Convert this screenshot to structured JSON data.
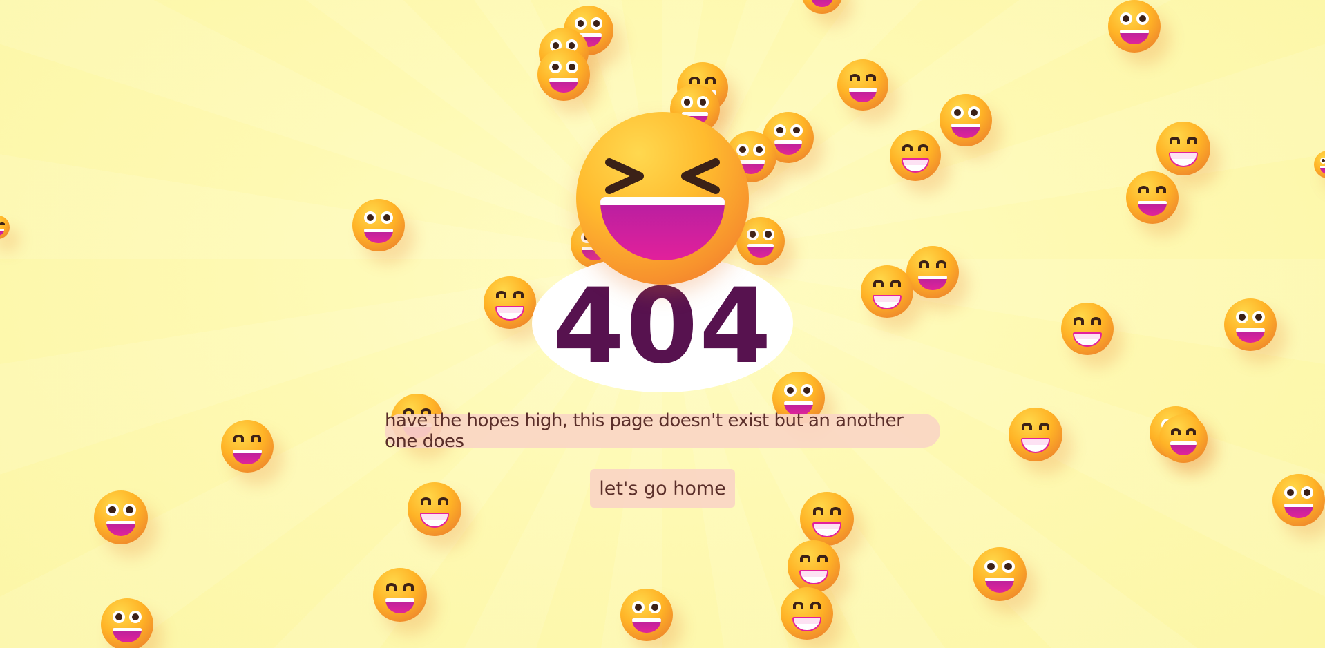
{
  "page": {
    "error_code": "404",
    "message": "have the hopes high, this page doesn't exist but an another one does",
    "home_button_label": "let's go home"
  },
  "theme": {
    "background": "#fef9b2",
    "code_color": "#57124f",
    "pill_color": "#fad6c4",
    "text_color": "#5b2f2a"
  },
  "icons": {
    "hero": "grinning-squinting-face-icon",
    "decorations": [
      "grinning-face-with-big-eyes-icon",
      "beaming-face-icon",
      "grinning-face-icon"
    ]
  }
}
